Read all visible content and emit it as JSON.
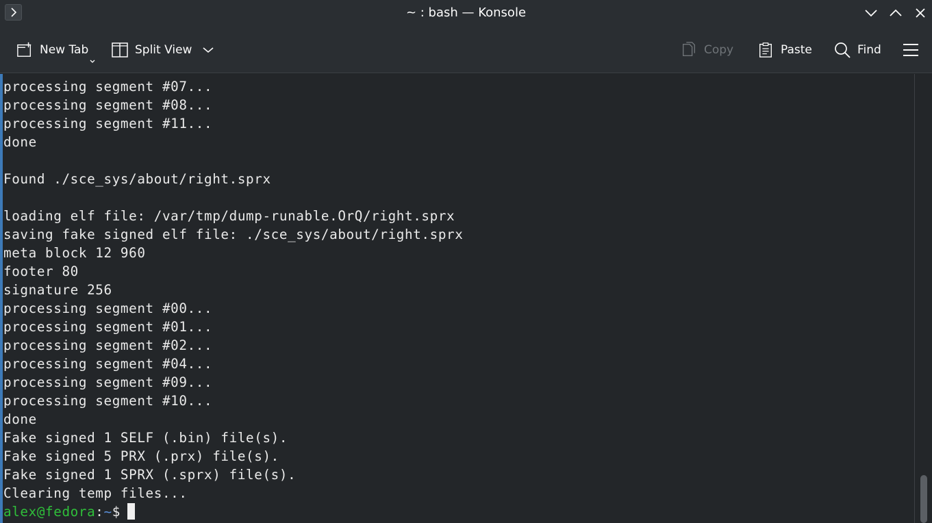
{
  "window": {
    "title": "~ : bash — Konsole"
  },
  "toolbar": {
    "new_tab_label": "New Tab",
    "split_view_label": "Split View",
    "copy_label": "Copy",
    "paste_label": "Paste",
    "find_label": "Find"
  },
  "terminal": {
    "lines": [
      "processing segment #07...",
      "processing segment #08...",
      "processing segment #11...",
      "done",
      "",
      "Found ./sce_sys/about/right.sprx",
      "",
      "loading elf file: /var/tmp/dump-runable.OrQ/right.sprx",
      "saving fake signed elf file: ./sce_sys/about/right.sprx",
      "meta block 12 960",
      "footer 80",
      "signature 256",
      "processing segment #00...",
      "processing segment #01...",
      "processing segment #02...",
      "processing segment #04...",
      "processing segment #09...",
      "processing segment #10...",
      "done",
      "Fake signed 1 SELF (.bin) file(s).",
      "Fake signed 5 PRX (.prx) file(s).",
      "Fake signed 1 SPRX (.sprx) file(s).",
      "Clearing temp files..."
    ],
    "prompt_user_host": "alex@fedora",
    "prompt_sep": ":",
    "prompt_path": "~",
    "prompt_symbol": "$"
  },
  "colors": {
    "background": "#232629",
    "prompt_user": "#2fbf3a",
    "prompt_path": "#5a8fd8",
    "focus_accent": "#3d7ab8"
  }
}
